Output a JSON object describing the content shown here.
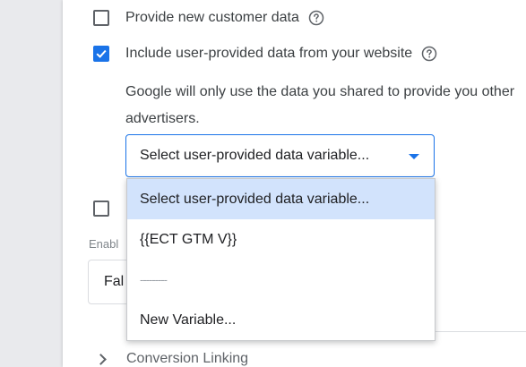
{
  "settings": {
    "provide_new_customer": {
      "label": "Provide new customer data",
      "checked": false
    },
    "include_user_provided": {
      "label": "Include user-provided data from your website",
      "checked": true
    },
    "description": "Google will only use the data you shared to provide you other advertisers.",
    "select": {
      "value": "Select user-provided data variable..."
    },
    "enable_label": "Enabl",
    "field_value": "Fal",
    "conversion_linking": {
      "label": "Conversion Linking"
    }
  },
  "dropdown": {
    "options": [
      {
        "label": "Select user-provided data variable...",
        "selected": true
      },
      {
        "label": "{{ECT GTM V}}",
        "selected": false
      },
      {
        "label": "---------",
        "selected": false
      },
      {
        "label": "New Variable...",
        "selected": false
      }
    ]
  },
  "colors": {
    "accent": "#1a73e8",
    "selected_option": "#d2e3fc"
  },
  "icons": {
    "help": "help-circle-icon",
    "check": "check-icon",
    "caret": "caret-down-icon",
    "chevron": "chevron-right-icon"
  }
}
